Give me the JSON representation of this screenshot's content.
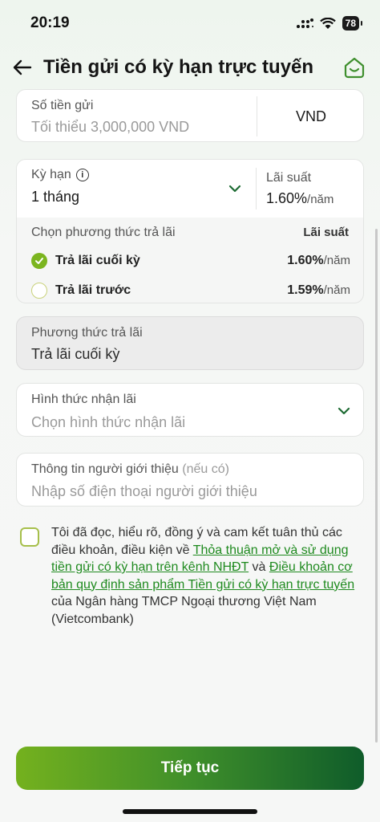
{
  "status_bar": {
    "time": "20:19",
    "battery": "78"
  },
  "header": {
    "title": "Tiền gửi có kỳ hạn trực tuyến"
  },
  "amount": {
    "label": "Số tiền gửi",
    "placeholder": "Tối thiểu 3,000,000 VND",
    "currency": "VND"
  },
  "term": {
    "label": "Kỳ hạn",
    "value": "1 tháng",
    "rate_label": "Lãi suất",
    "rate_value": "1.60%",
    "rate_unit": "/năm",
    "method_title": "Chọn phương thức trả lãi",
    "method_rate_title": "Lãi suất",
    "options": [
      {
        "label": "Trả lãi cuối kỳ",
        "rate": "1.60%",
        "unit": "/năm",
        "selected": true
      },
      {
        "label": "Trả lãi trước",
        "rate": "1.59%",
        "unit": "/năm",
        "selected": false
      }
    ]
  },
  "payment_method": {
    "label": "Phương thức trả lãi",
    "value": "Trả lãi cuối kỳ"
  },
  "receive": {
    "label": "Hình thức nhận lãi",
    "placeholder": "Chọn hình thức nhận lãi"
  },
  "referral": {
    "label": "Thông tin người giới thiệu",
    "optional": "(nếu có)",
    "placeholder": "Nhập số điện thoại người giới thiệu"
  },
  "agreement": {
    "text_1": "Tôi đã đọc, hiểu rõ, đồng ý và cam kết tuân thủ các điều khoản, điều kiện về ",
    "link_1": "Thỏa thuận mở và sử dụng tiền gửi có kỳ hạn trên kênh NHĐT",
    "text_2": " và ",
    "link_2": "Điều khoản cơ bản quy định sản phẩm Tiền gửi có kỳ hạn trực tuyến",
    "text_3": " của Ngân hàng TMCP Ngoại thương Việt Nam (Vietcombank)"
  },
  "cta": {
    "label": "Tiếp tục"
  },
  "colors": {
    "accent_green": "#7bb51f",
    "dark_green": "#0f5c2a",
    "link_green": "#1f8a1f"
  }
}
